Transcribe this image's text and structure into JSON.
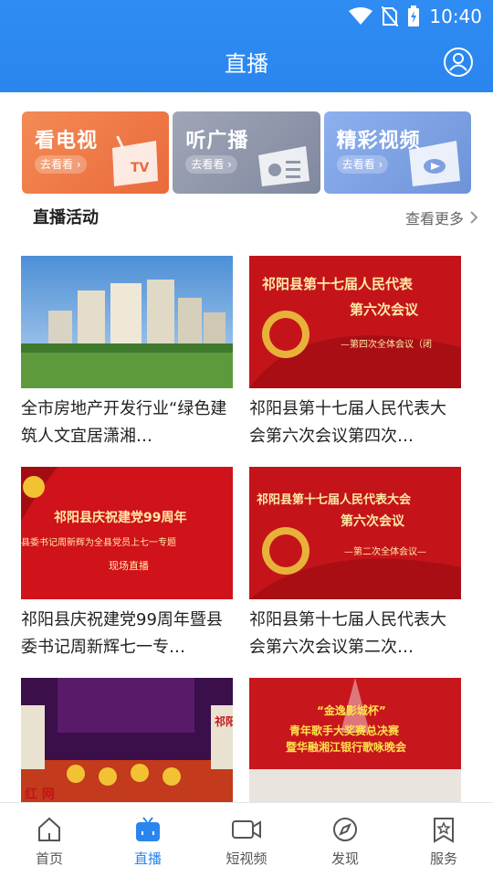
{
  "status": {
    "time": "10:40"
  },
  "header": {
    "title": "直播"
  },
  "tiles": [
    {
      "title": "看电视",
      "button": "去看看 ›",
      "color": "#f07a45",
      "art_label": "TV"
    },
    {
      "title": "听广播",
      "button": "去看看 ›",
      "color": "#8f96a9"
    },
    {
      "title": "精彩视频",
      "button": "去看看 ›",
      "color": "#7fa0e0"
    }
  ],
  "section": {
    "title": "直播活动",
    "more": "查看更多"
  },
  "cards": [
    {
      "title": "全市房地产开发行业“绿色建筑人文宜居潇湘…",
      "thumb": "buildings"
    },
    {
      "title": "祁阳县第十七届人民代表大会第六次会议第四次…",
      "thumb": "congress",
      "thumb_text_1": "祁阳县第十七届人民代表",
      "thumb_text_2": "第六次会议",
      "thumb_text_3": "—第四次全体会议（闭"
    },
    {
      "title": "祁阳县庆祝建党99周年暨县委书记周新辉七一专…",
      "thumb": "party",
      "thumb_text_1": "祁阳县庆祝建党99周年",
      "thumb_text_2": "县委书记周新辉为全县党员上七一专题",
      "thumb_text_3": "现场直播"
    },
    {
      "title": "祁阳县第十七届人民代表大会第六次会议第二次…",
      "thumb": "congress",
      "thumb_text_1": "祁阳县第十七届人民代表大会",
      "thumb_text_2": "第六次会议",
      "thumb_text_3": "—第二次全体会议—"
    },
    {
      "title": "",
      "thumb": "stage",
      "thumb_text_1": "祁阳",
      "thumb_text_2": "红 网"
    },
    {
      "title": "",
      "thumb": "gala",
      "thumb_text_1": "“金逸影城杯”",
      "thumb_text_2": "青年歌手大奖赛总决赛",
      "thumb_text_3": "暨华融湘江银行歌咏晚会"
    }
  ],
  "tabbar": [
    {
      "label": "首页",
      "icon": "home-icon",
      "active": false
    },
    {
      "label": "直播",
      "icon": "live-tv-icon",
      "active": true
    },
    {
      "label": "短视频",
      "icon": "video-camera-icon",
      "active": false
    },
    {
      "label": "发现",
      "icon": "compass-icon",
      "active": false
    },
    {
      "label": "服务",
      "icon": "bookmark-star-icon",
      "active": false
    }
  ],
  "colors": {
    "brand": "#2a86ee",
    "text": "#222222"
  }
}
